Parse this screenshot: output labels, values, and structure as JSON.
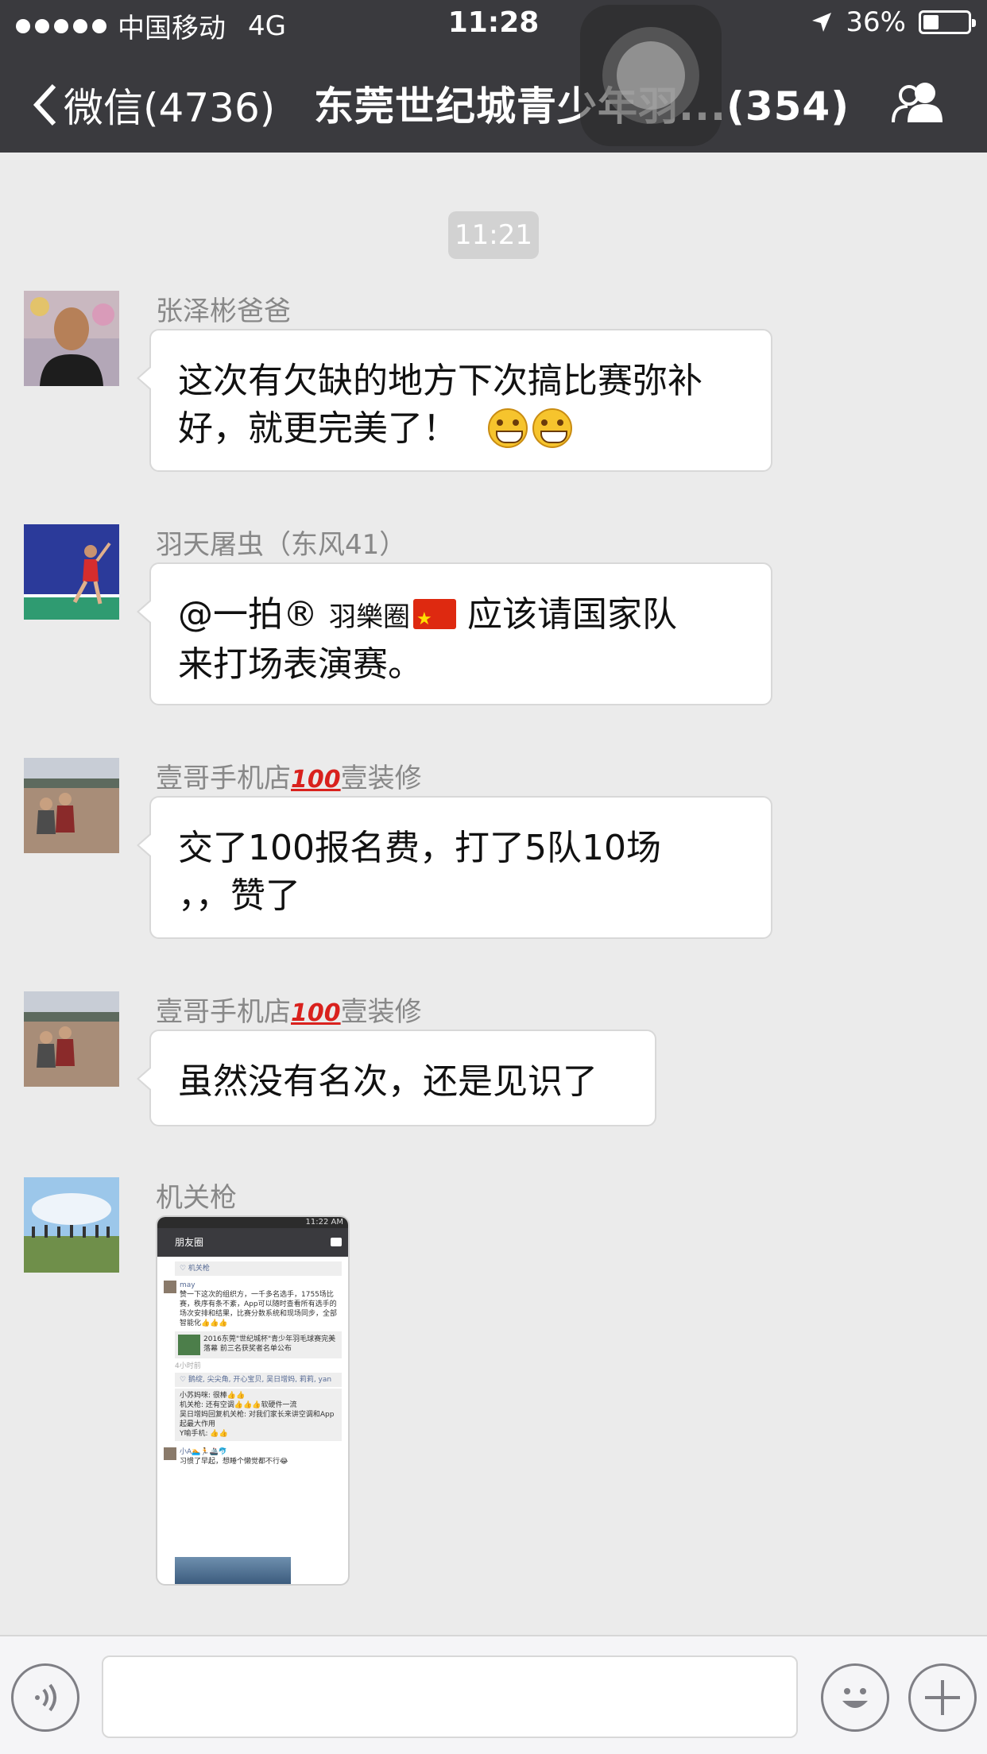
{
  "status_bar": {
    "carrier": "中国移动",
    "network": "4G",
    "time": "11:28",
    "battery": "36%",
    "battery_level": 0.36
  },
  "nav": {
    "back_label": "微信(4736)",
    "title": "东莞世纪城青少年羽...(354)",
    "icon": "group-members-icon"
  },
  "chat": {
    "timestamp": "11:21",
    "messages": [
      {
        "sender": "张泽彬爸爸",
        "lines": [
          "这次有欠缺的地方下次搞比赛弥补",
          "好，就更完美了！"
        ],
        "emoji": "grinning-face"
      },
      {
        "sender": "羽天屠虫（东风41）",
        "mention": "@一拍®",
        "mention_suffix": "羽樂圈",
        "line1_rest": "应该请国家队",
        "line2": "来打场表演赛。"
      },
      {
        "sender_prefix": "壹哥手机店",
        "sender_badge": "100",
        "sender_suffix": "壹装修",
        "lines": [
          "交了100报名费，打了5队10场",
          "，，赞了"
        ]
      },
      {
        "sender_prefix": "壹哥手机店",
        "sender_badge": "100",
        "sender_suffix": "壹装修",
        "lines": [
          "虽然没有名次，还是见识了"
        ]
      },
      {
        "sender": "机关枪",
        "image": {
          "status_time": "11:22 AM",
          "header": "朋友圈",
          "liker": "♡ 机关枪",
          "author": "may",
          "post": "赞一下这次的组织方，一千多名选手，1755场比赛，秩序有条不紊，App可以随时查看所有选手的场次安排和结果，比赛分数系统和现场同步，全部智能化👍👍👍",
          "link_title": "2016东莞\"世纪城杯\"青少年羽毛球赛完美落幕 前三名获奖者名单公布",
          "time_ago": "4小时前",
          "likes": "♡ 鹅绽, 尖尖角, 开心宝贝, 吴日增妈, 莉莉, yan",
          "comments": [
            "小苏妈咪: 很棒👍👍",
            "机关枪: 还有空调👍👍👍软硬件一流",
            "吴日增妈回复机关枪: 对我们家长来讲空调和App起最大作用",
            "Y喻手机: 👍👍"
          ],
          "next_author": "小A🏊🏃🚢🐬",
          "next_post": "习惯了早起，想睡个懒觉都不行😂"
        }
      }
    ]
  },
  "input_bar": {
    "voice_icon": "voice-icon",
    "input_value": "",
    "emoji_icon": "emoji-icon",
    "plus_icon": "plus-icon"
  }
}
